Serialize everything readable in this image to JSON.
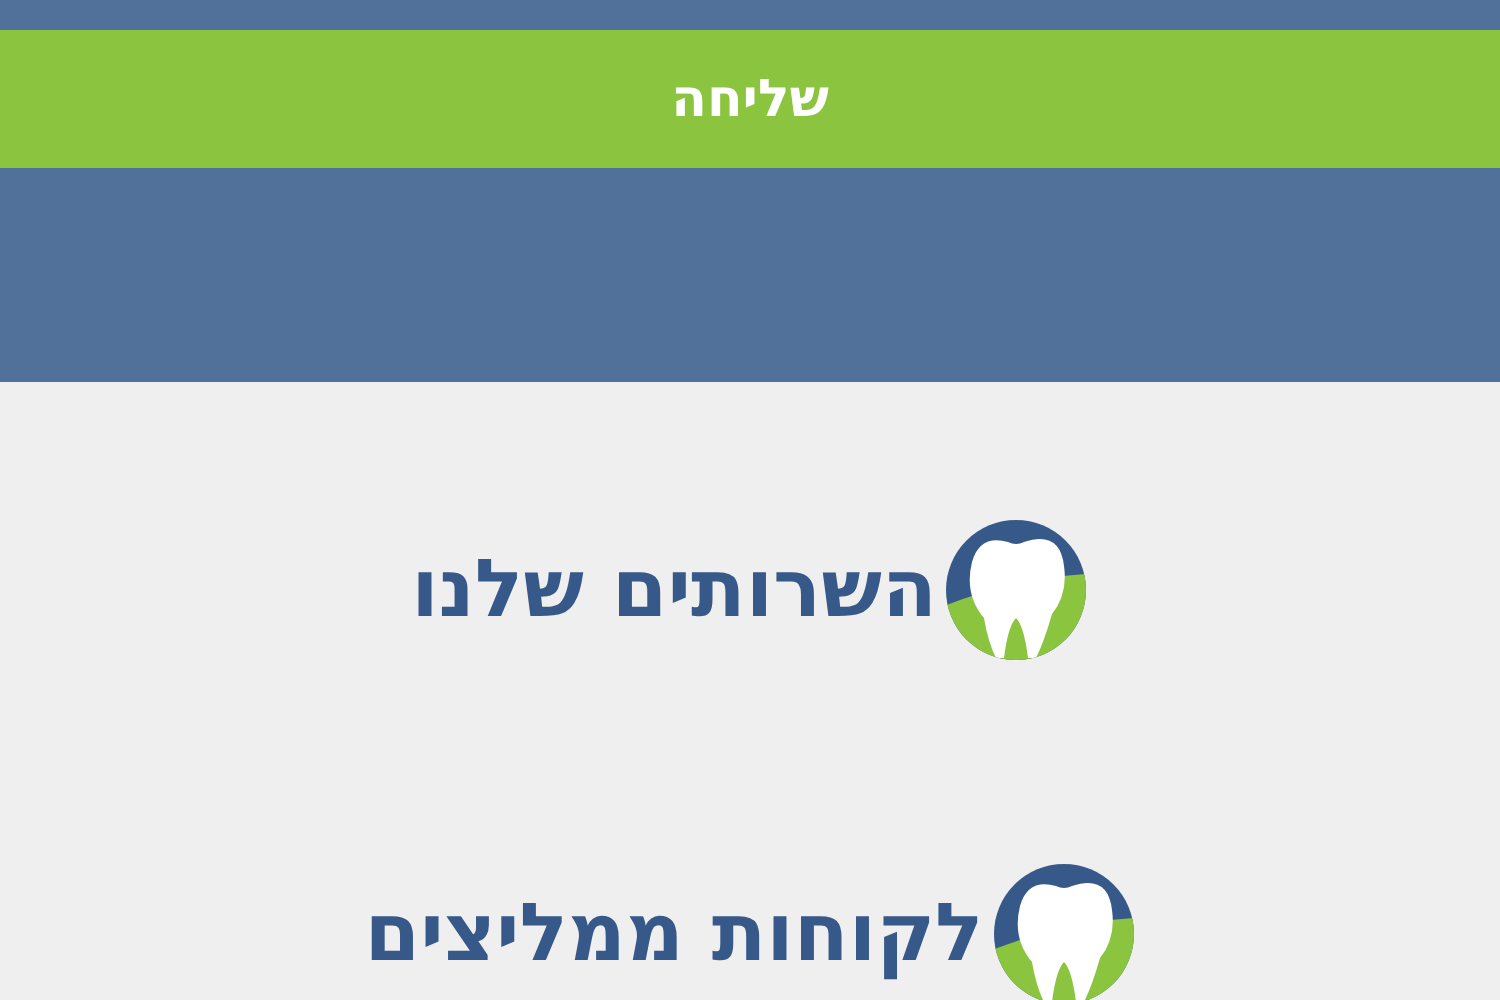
{
  "submit_button": {
    "label": "שליחה"
  },
  "sections": [
    {
      "title": "השרותים שלנו"
    },
    {
      "title": "לקוחות ממליצים"
    }
  ]
}
